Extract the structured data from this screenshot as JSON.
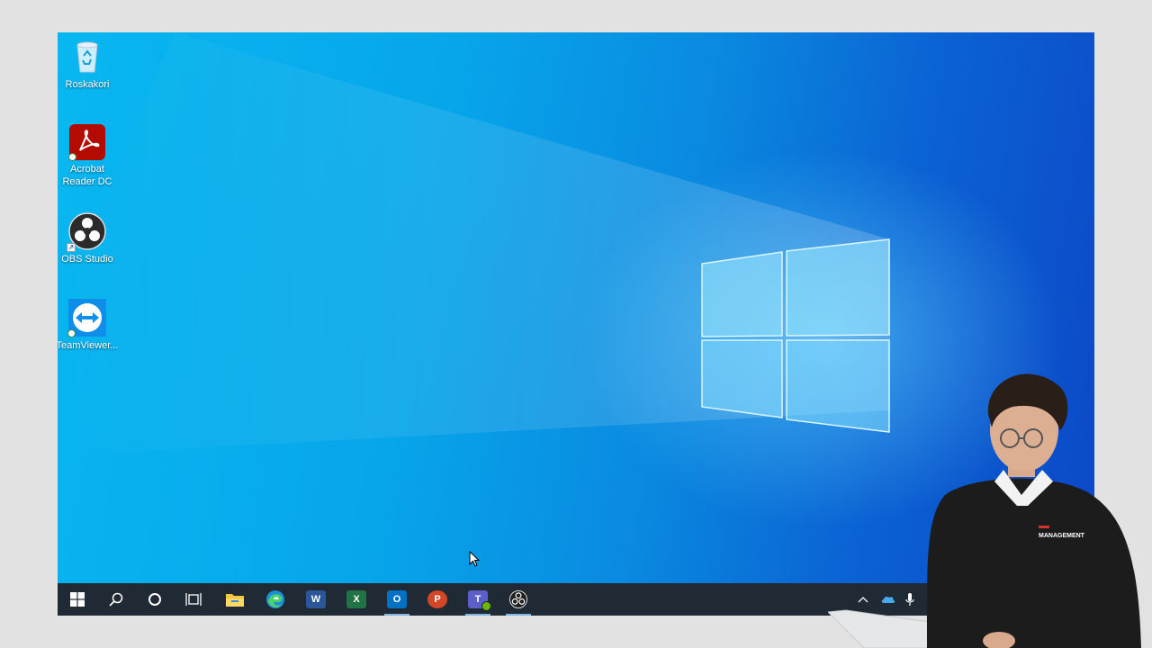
{
  "desktop": {
    "icons": [
      {
        "label": "Roskakori",
        "icon": "recycle-bin-icon"
      },
      {
        "label": "Acrobat Reader DC",
        "icon": "acrobat-reader-icon"
      },
      {
        "label": "OBS Studio",
        "icon": "obs-studio-icon"
      },
      {
        "label": "TeamViewer...",
        "icon": "teamviewer-icon"
      }
    ]
  },
  "taskbar": {
    "items": [
      {
        "icon": "windows-start-icon"
      },
      {
        "icon": "search-icon"
      },
      {
        "icon": "cortana-icon"
      },
      {
        "icon": "task-view-icon"
      },
      {
        "icon": "file-explorer-icon"
      },
      {
        "icon": "edge-icon"
      },
      {
        "icon": "word-icon",
        "letter": "W"
      },
      {
        "icon": "excel-icon",
        "letter": "X"
      },
      {
        "icon": "outlook-icon",
        "letter": "O",
        "active": true
      },
      {
        "icon": "powerpoint-icon",
        "letter": "P"
      },
      {
        "icon": "teams-icon",
        "letter": "T",
        "active": true
      },
      {
        "icon": "obs-studio-icon",
        "active": true
      }
    ],
    "tray": [
      {
        "icon": "chevron-up-icon"
      },
      {
        "icon": "onedrive-icon"
      },
      {
        "icon": "microphone-icon"
      }
    ]
  },
  "colors": {
    "wallpaper_light": "#08b7f0",
    "wallpaper_dark": "#0c47c6",
    "taskbar": "#1f2a34",
    "word": "#2b579a",
    "excel": "#217346",
    "outlook": "#0072c6",
    "powerpoint": "#d24726",
    "teams": "#5b5fc7"
  },
  "presenter_shirt_text": "MANAGEMENT"
}
